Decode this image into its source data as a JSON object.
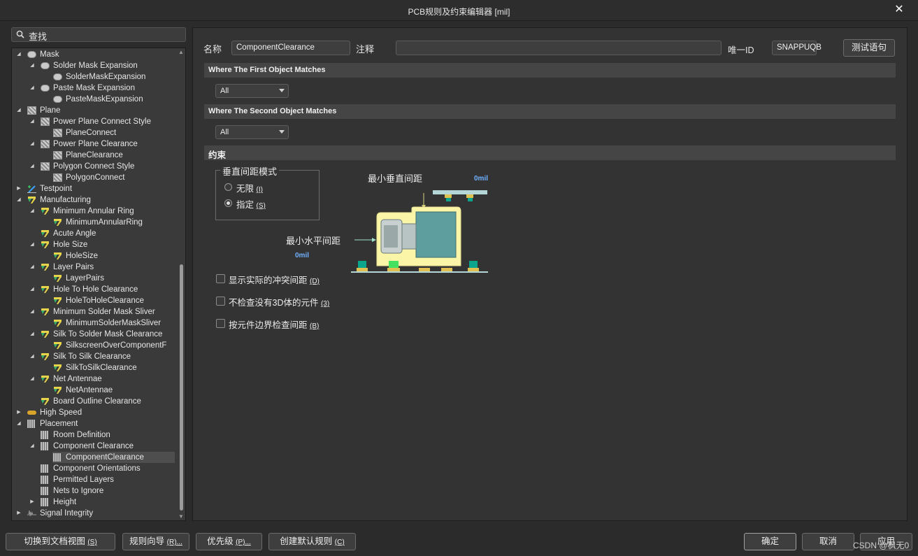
{
  "window": {
    "title": "PCB规则及约束编辑器 [mil]",
    "close": "✕"
  },
  "search": {
    "placeholder": "查找"
  },
  "tree": [
    {
      "label": "Mask",
      "level": 0,
      "icon": "mask-icon",
      "expanded": true
    },
    {
      "label": "Solder Mask Expansion",
      "level": 1,
      "icon": "mask-icon",
      "expanded": true
    },
    {
      "label": "SolderMaskExpansion",
      "level": 2,
      "icon": "mask-icon"
    },
    {
      "label": "Paste Mask Expansion",
      "level": 1,
      "icon": "mask-icon",
      "expanded": true
    },
    {
      "label": "PasteMaskExpansion",
      "level": 2,
      "icon": "mask-icon"
    },
    {
      "label": "Plane",
      "level": 0,
      "icon": "plane-icon",
      "expanded": true
    },
    {
      "label": "Power Plane Connect Style",
      "level": 1,
      "icon": "plane-icon",
      "expanded": true
    },
    {
      "label": "PlaneConnect",
      "level": 2,
      "icon": "plane-icon"
    },
    {
      "label": "Power Plane Clearance",
      "level": 1,
      "icon": "plane-icon",
      "expanded": true
    },
    {
      "label": "PlaneClearance",
      "level": 2,
      "icon": "plane-icon"
    },
    {
      "label": "Polygon Connect Style",
      "level": 1,
      "icon": "plane-icon",
      "expanded": true
    },
    {
      "label": "PolygonConnect",
      "level": 2,
      "icon": "plane-icon"
    },
    {
      "label": "Testpoint",
      "level": 0,
      "icon": "testpoint-icon",
      "expanded": false
    },
    {
      "label": "Manufacturing",
      "level": 0,
      "icon": "manufacturing-icon",
      "expanded": true
    },
    {
      "label": "Minimum Annular Ring",
      "level": 1,
      "icon": "manufacturing-icon",
      "expanded": true
    },
    {
      "label": "MinimumAnnularRing",
      "level": 2,
      "icon": "manufacturing-icon"
    },
    {
      "label": "Acute Angle",
      "level": 1,
      "icon": "manufacturing-icon"
    },
    {
      "label": "Hole Size",
      "level": 1,
      "icon": "manufacturing-icon",
      "expanded": true
    },
    {
      "label": "HoleSize",
      "level": 2,
      "icon": "manufacturing-icon"
    },
    {
      "label": "Layer Pairs",
      "level": 1,
      "icon": "manufacturing-icon",
      "expanded": true
    },
    {
      "label": "LayerPairs",
      "level": 2,
      "icon": "manufacturing-icon"
    },
    {
      "label": "Hole To Hole Clearance",
      "level": 1,
      "icon": "manufacturing-icon",
      "expanded": true
    },
    {
      "label": "HoleToHoleClearance",
      "level": 2,
      "icon": "manufacturing-icon"
    },
    {
      "label": "Minimum Solder Mask Sliver",
      "level": 1,
      "icon": "manufacturing-icon",
      "expanded": true
    },
    {
      "label": "MinimumSolderMaskSliver",
      "level": 2,
      "icon": "manufacturing-icon"
    },
    {
      "label": "Silk To Solder Mask Clearance",
      "level": 1,
      "icon": "manufacturing-icon",
      "expanded": true
    },
    {
      "label": "SilkscreenOverComponentF",
      "level": 2,
      "icon": "manufacturing-icon"
    },
    {
      "label": "Silk To Silk Clearance",
      "level": 1,
      "icon": "manufacturing-icon",
      "expanded": true
    },
    {
      "label": "SilkToSilkClearance",
      "level": 2,
      "icon": "manufacturing-icon"
    },
    {
      "label": "Net Antennae",
      "level": 1,
      "icon": "manufacturing-icon",
      "expanded": true
    },
    {
      "label": "NetAntennae",
      "level": 2,
      "icon": "manufacturing-icon"
    },
    {
      "label": "Board Outline Clearance",
      "level": 1,
      "icon": "manufacturing-icon"
    },
    {
      "label": "High Speed",
      "level": 0,
      "icon": "high-speed-icon",
      "expanded": false
    },
    {
      "label": "Placement",
      "level": 0,
      "icon": "placement-icon",
      "expanded": true
    },
    {
      "label": "Room Definition",
      "level": 1,
      "icon": "placement-icon"
    },
    {
      "label": "Component Clearance",
      "level": 1,
      "icon": "placement-icon",
      "expanded": true
    },
    {
      "label": "ComponentClearance",
      "level": 2,
      "icon": "placement-icon",
      "selected": true
    },
    {
      "label": "Component Orientations",
      "level": 1,
      "icon": "placement-icon"
    },
    {
      "label": "Permitted Layers",
      "level": 1,
      "icon": "placement-icon"
    },
    {
      "label": "Nets to Ignore",
      "level": 1,
      "icon": "placement-icon"
    },
    {
      "label": "Height",
      "level": 1,
      "icon": "placement-icon",
      "expanded": false
    },
    {
      "label": "Signal Integrity",
      "level": 0,
      "icon": "signal-integrity-icon",
      "expanded": false
    }
  ],
  "rule": {
    "name_label": "名称",
    "name_value": "ComponentClearance",
    "comment_label": "注释",
    "comment_value": "",
    "uid_label": "唯一ID",
    "uid_value": "SNAPPUQB",
    "test_button": "测试语句"
  },
  "first_match": {
    "header": "Where The First Object Matches",
    "value": "All"
  },
  "second_match": {
    "header": "Where The Second Object Matches",
    "value": "All"
  },
  "constraints": {
    "header": "约束",
    "group_title": "垂直间距模式",
    "radio_unlimited": "无限",
    "radio_unlimited_key": "(I)",
    "radio_specified": "指定",
    "radio_specified_key": "(S)",
    "selected_mode": "specified",
    "min_vertical_label": "最小垂直间距",
    "min_vertical_value": "0mil",
    "min_horizontal_label": "最小水平间距",
    "min_horizontal_value": "0mil",
    "checkboxes": [
      {
        "label": "显示实际的冲突间距",
        "key": "(D)",
        "checked": false
      },
      {
        "label": "不检查没有3D体的元件",
        "key": "(3)",
        "checked": false
      },
      {
        "label": "按元件边界检查间距",
        "key": "(B)",
        "checked": false
      }
    ]
  },
  "footer": {
    "switch_view": "切换到文档视图",
    "switch_view_key": "(S)",
    "rule_wizard": "规则向导",
    "rule_wizard_key": "(R)...",
    "priority": "优先级",
    "priority_key": "(P)...",
    "create_default": "创建默认规则",
    "create_default_key": "(C)",
    "ok": "确定",
    "cancel": "取消",
    "apply": "应用"
  },
  "watermark": "CSDN @枫无0"
}
